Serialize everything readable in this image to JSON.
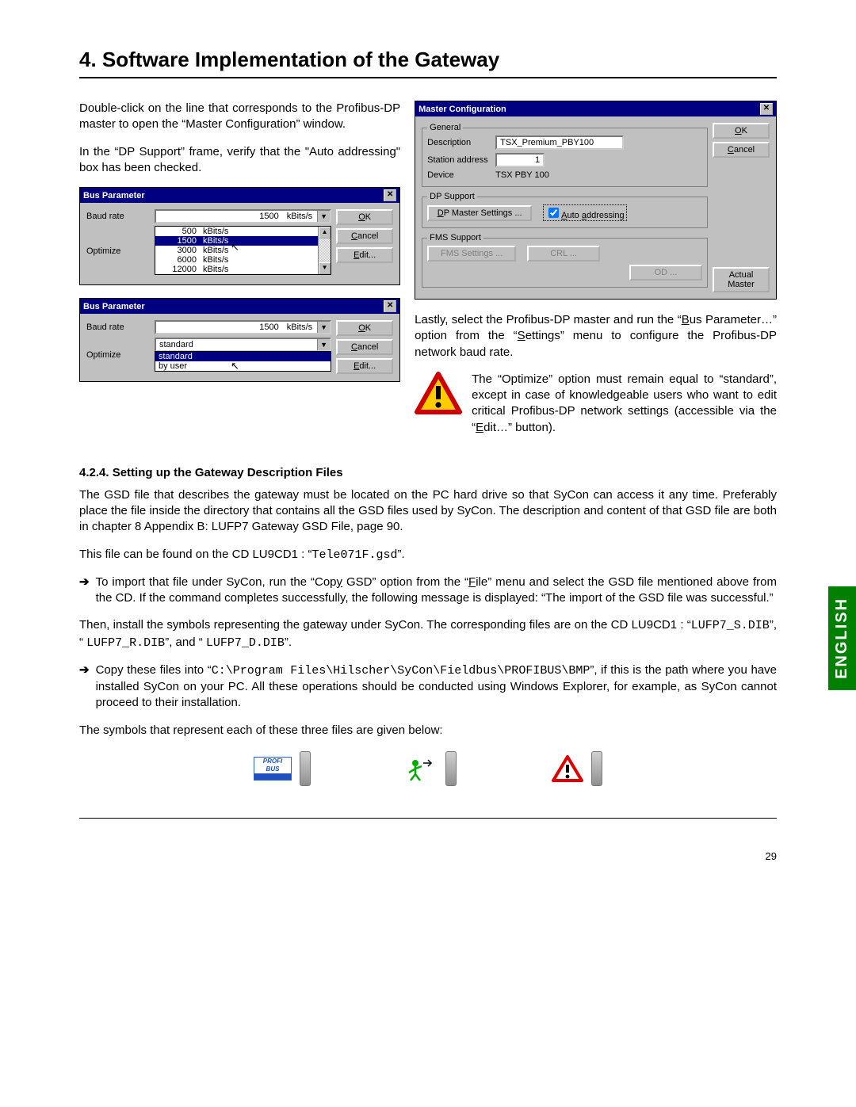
{
  "title": "4. Software Implementation of the Gateway",
  "intro1": "Double-click on the line that corresponds to the Profibus-DP master to open the “Master Configuration” window.",
  "intro2": "In the “DP Support” frame, verify that the \"Auto addressing\" box has been checked.",
  "rightText1": "Lastly, select the Profibus-DP master and run the “",
  "rightText1b": "us Parameter…” option from the “",
  "rightText1c": "ettings” menu to configure the Profibus-DP network baud rate.",
  "warnText": "The “Optimize” option must remain equal to “standard”, except in case of knowledgeable users who want to edit critical Profibus-DP network settings (accessible via the “",
  "warnText2": "dit…” button).",
  "busParam": {
    "title": "Bus Parameter",
    "baud": "Baud rate",
    "opt": "Optimize",
    "ok": "OK",
    "cancel": "Cancel",
    "edit": "Edit...",
    "val": "1500",
    "unit": "kBits/s",
    "opts": [
      [
        "500",
        "kBits/s"
      ],
      [
        "1500",
        "kBits/s"
      ],
      [
        "3000",
        "kBits/s"
      ],
      [
        "6000",
        "kBits/s"
      ],
      [
        "12000",
        "kBits/s"
      ]
    ],
    "std": "standard",
    "stdOpts": [
      "standard",
      "by user"
    ]
  },
  "master": {
    "title": "Master Configuration",
    "general": "General",
    "desc": "Description",
    "descV": "TSX_Premium_PBY100",
    "sa": "Station address",
    "saV": "1",
    "dev": "Device",
    "devV": "TSX PBY 100",
    "dp": "DP Support",
    "dpm": "DP Master Settings ...",
    "auto": "Auto addressing",
    "fms": "FMS Support",
    "fmss": "FMS Settings ...",
    "crl": "CRL ...",
    "od": "OD ...",
    "ok": "OK",
    "cancel": "Cancel",
    "actual": "Actual Master"
  },
  "sec424": "4.2.4. Setting up the Gateway Description Files",
  "p1": "The GSD file that describes the gateway must be located on the PC hard drive so that SyCon can access it any time. Preferably place the file inside the directory that contains all the GSD files used by SyCon. The description and content of that GSD file are both in chapter 8 Appendix B: LUFP7 Gateway GSD File, page 90.",
  "p2a": "This file can be found on the CD LU9CD1 : “",
  "p2b": "Tele071F.gsd",
  "p2c": "”.",
  "b1a": "To import that file under SyCon, run the “Cop",
  "b1b": " GSD” option from the “",
  "b1c": "ile” menu and select the GSD file mentioned above from the CD. If the command completes successfully, the following message is displayed: “The import of the GSD file was successful.”",
  "p3a": "Then, install the symbols representing the gateway under SyCon. The corresponding files are on the CD LU9CD1 : “",
  "f1": "LUFP7_S.DIB",
  "p3b": "”, “ ",
  "f2": "LUFP7_R.DIB",
  "p3c": "”, and “ ",
  "f3": "LUFP7_D.DIB",
  "p3d": "”.",
  "b2a": "Copy these files into “",
  "path": "C:\\Program Files\\Hilscher\\SyCon\\Fieldbus\\PROFIBUS\\BMP",
  "b2b": "”, if this is the path where you have installed SyCon on your PC. All these operations should be conducted using Windows Explorer, for example, as SyCon cannot proceed to their installation.",
  "p4": "The symbols that represent each of these three files are given below:",
  "lang": "ENGLISH",
  "page": "29"
}
